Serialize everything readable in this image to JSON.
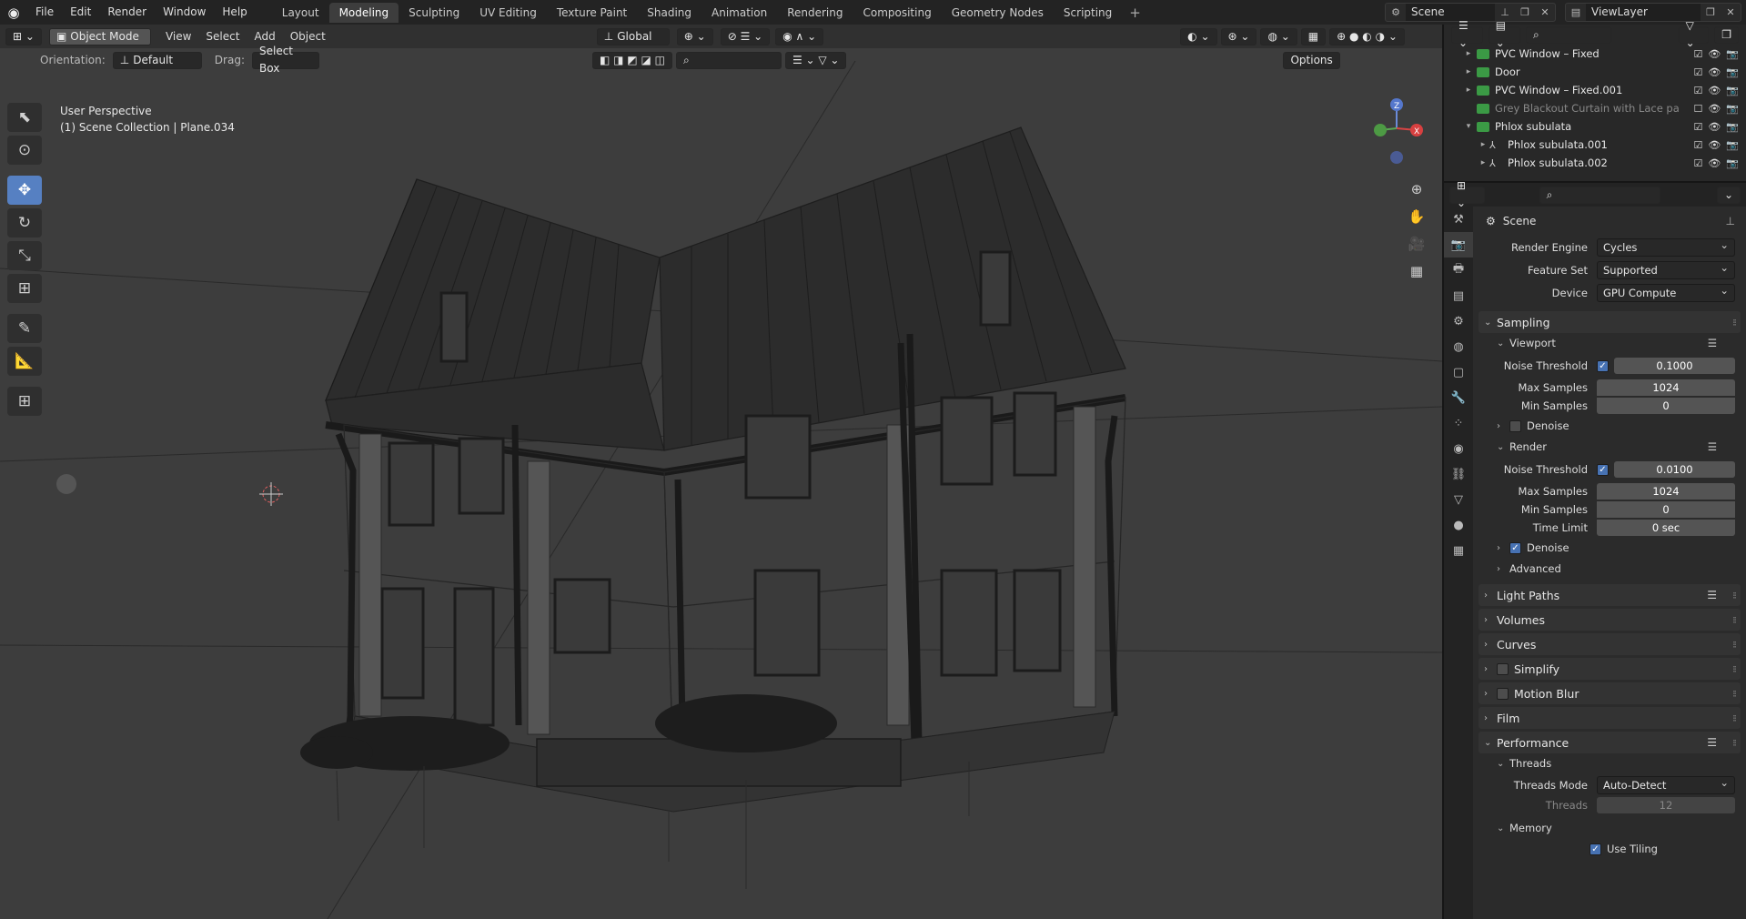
{
  "menu": [
    "File",
    "Edit",
    "Render",
    "Window",
    "Help"
  ],
  "workspaces": [
    "Layout",
    "Modeling",
    "Sculpting",
    "UV Editing",
    "Texture Paint",
    "Shading",
    "Animation",
    "Rendering",
    "Compositing",
    "Geometry Nodes",
    "Scripting"
  ],
  "active_workspace": "Modeling",
  "plus": "+",
  "scene_name": "Scene",
  "view_layer": "ViewLayer",
  "viewport": {
    "mode": "Object Mode",
    "menus": [
      "View",
      "Select",
      "Add",
      "Object"
    ],
    "transform_orientation": "Global",
    "orientation_label": "Orientation:",
    "orientation_value": "Default",
    "drag_label": "Drag:",
    "drag_value": "Select Box",
    "options": "Options",
    "info_line1": "User Perspective",
    "info_line2": "(1) Scene Collection | Plane.034"
  },
  "outliner": {
    "rows": [
      {
        "name": "PVC Window – Fixed",
        "arrow": "▸",
        "type": "collection",
        "dim": false
      },
      {
        "name": "Door",
        "arrow": "▸",
        "type": "collection",
        "dim": false
      },
      {
        "name": "PVC Window – Fixed.001",
        "arrow": "▸",
        "type": "collection",
        "dim": false
      },
      {
        "name": "Grey Blackout Curtain with Lace pa",
        "arrow": "",
        "type": "collection",
        "dim": true
      },
      {
        "name": "Phlox subulata",
        "arrow": "▾",
        "type": "collection",
        "dim": false
      },
      {
        "name": "Phlox subulata.001",
        "arrow": "▸",
        "type": "object",
        "dim": false
      },
      {
        "name": "Phlox subulata.002",
        "arrow": "▸",
        "type": "object",
        "dim": false
      }
    ]
  },
  "properties": {
    "context": "Scene",
    "render_engine_label": "Render Engine",
    "render_engine": "Cycles",
    "feature_set_label": "Feature Set",
    "feature_set": "Supported",
    "device_label": "Device",
    "device": "GPU Compute",
    "sampling": "Sampling",
    "viewport": "Viewport",
    "noise_threshold_label": "Noise Threshold",
    "vp_noise_threshold": "0.1000",
    "max_samples_label": "Max Samples",
    "vp_max_samples": "1024",
    "min_samples_label": "Min Samples",
    "vp_min_samples": "0",
    "denoise": "Denoise",
    "render": "Render",
    "r_noise_threshold": "0.0100",
    "r_max_samples": "1024",
    "r_min_samples": "0",
    "time_limit_label": "Time Limit",
    "r_time_limit": "0 sec",
    "advanced": "Advanced",
    "light_paths": "Light Paths",
    "volumes": "Volumes",
    "curves": "Curves",
    "simplify": "Simplify",
    "motion_blur": "Motion Blur",
    "film": "Film",
    "performance": "Performance",
    "threads": "Threads",
    "threads_mode_label": "Threads Mode",
    "threads_mode": "Auto-Detect",
    "threads_label": "Threads",
    "threads_value": "12",
    "memory": "Memory",
    "use_tiling": "Use Tiling"
  }
}
